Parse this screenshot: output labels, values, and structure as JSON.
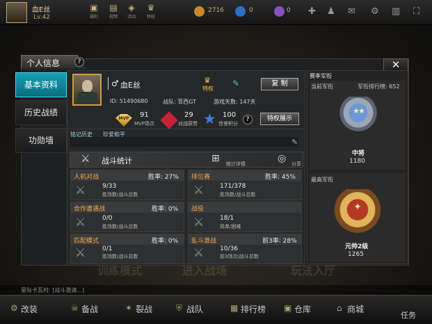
{
  "player": {
    "name": "血E丝",
    "level": "Lv.42"
  },
  "topbar": {
    "icons": [
      "福利",
      "视频",
      "活动",
      "特权"
    ],
    "currency1": "2716",
    "currency2": "0",
    "currency3": "0"
  },
  "background": {
    "label1": "训练模式",
    "label2": "进入战场",
    "label3": "玩法入厅"
  },
  "panel": {
    "title": "个人信息",
    "help": "?",
    "close": "✕"
  },
  "sidebar": {
    "items": [
      {
        "label": "基本资料"
      },
      {
        "label": "历史战绩"
      },
      {
        "label": "功勋墙"
      }
    ]
  },
  "profile": {
    "name": "血E丝",
    "privilege_label": "特权",
    "copy_button": "复 制",
    "id_text": "ID: 51490680",
    "team_text": "战队: 菲西GT",
    "days_text": "游戏天数: 147天",
    "stats": {
      "mvp_value": "91",
      "mvp_label": "MVP场次",
      "win_value": "29",
      "win_label": "对战获赞",
      "credit_value": "100",
      "credit_label": "信誉积分"
    },
    "privilege_button": "特权展示",
    "tags": {
      "label1": "铭记历史",
      "label2": "珍爱和平"
    }
  },
  "battle": {
    "title": "战斗统计",
    "detail_label": "统计详情",
    "share_label": "分享",
    "modes": [
      {
        "name": "人机对战",
        "rate": "胜率: 27%",
        "value": "9/33",
        "sub": "胜场数/战斗总数"
      },
      {
        "name": "排位赛",
        "rate": "胜率: 45%",
        "value": "171/378",
        "sub": "胜场数/战斗总数"
      },
      {
        "name": "合作遭遇战",
        "rate": "胜率: 0%",
        "value": "0/0",
        "sub": "胜场数/战斗总数"
      },
      {
        "name": "战役",
        "rate": "",
        "value": "18/1",
        "sub": "简单/困难"
      },
      {
        "name": "匹配模式",
        "rate": "胜率: 0%",
        "value": "0/1",
        "sub": "胜场数/战斗总数"
      },
      {
        "name": "乱斗激战",
        "rate": "前3率: 28%",
        "value": "10/36",
        "sub": "前3场次/战斗总数"
      }
    ]
  },
  "rank": {
    "section_title": "赛季军衔",
    "current_label": "当前军衔",
    "rank_ranking": "军衔排行榜: 652",
    "current_name": "中将",
    "current_points": "1180",
    "highest_label": "最高军衔",
    "highest_name": "元帅2级",
    "highest_points": "1265"
  },
  "chat": {
    "text": "星际卡瓦村: [战斗邀请...]"
  },
  "bottom_nav": {
    "items": [
      "改装",
      "备战",
      "裂战",
      "战队",
      "排行榜",
      "仓库",
      "商城"
    ],
    "task": "任务"
  }
}
